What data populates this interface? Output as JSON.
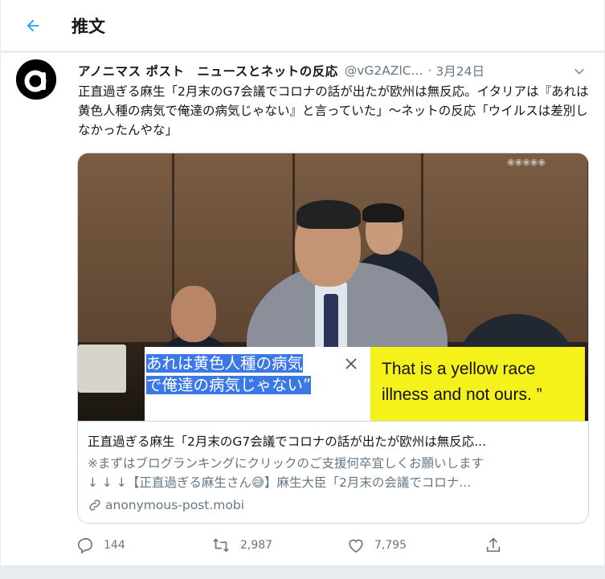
{
  "header": {
    "title": "推文"
  },
  "tweet": {
    "display_name": "アノニマス ポスト　ニュースとネットの反応",
    "handle": "@vG2AZlC...",
    "separator": "·",
    "date": "3月24日",
    "text": "正直過ぎる麻生「2月末のG7会議でコロナの話が出たが欧州は無反応。イタリアは『あれは黄色人種の病気で俺達の病気じゃない』と言っていた」〜ネットの反応「ウイルスは差別しなかったんやな」"
  },
  "card": {
    "subtitle_jp": "あれは黄色人種の病気で俺達の病気じゃない”",
    "subtitle_en": "That is a yellow race illness and not ours. ”",
    "title": "正直過ぎる麻生「2月末のG7会議でコロナの話が出たが欧州は無反応...",
    "desc_line1": "※まずはブログランキングにクリックのご支援何卒宜しくお願いします",
    "desc_line2_a": "↓ ↓ ↓【正直過ぎる麻生さん",
    "desc_emoji": "😅",
    "desc_line2_b": "】麻生大臣「2月末の会議でコロナ...",
    "link": "anonymous-post.mobi"
  },
  "actions": {
    "reply_count": "144",
    "retweet_count": "2,987",
    "like_count": "7,795"
  },
  "colors": {
    "accent": "#1da1f2",
    "muted": "#657786",
    "subtitle_highlight": "#3b78e7",
    "subtitle_yellow": "#f5f11a"
  },
  "icons": {
    "back": "arrow-left-icon",
    "caret": "chevron-down-icon",
    "reply": "reply-icon",
    "retweet": "retweet-icon",
    "like": "heart-icon",
    "share": "share-icon",
    "link": "link-icon",
    "avatar": "anonymous-logo"
  }
}
